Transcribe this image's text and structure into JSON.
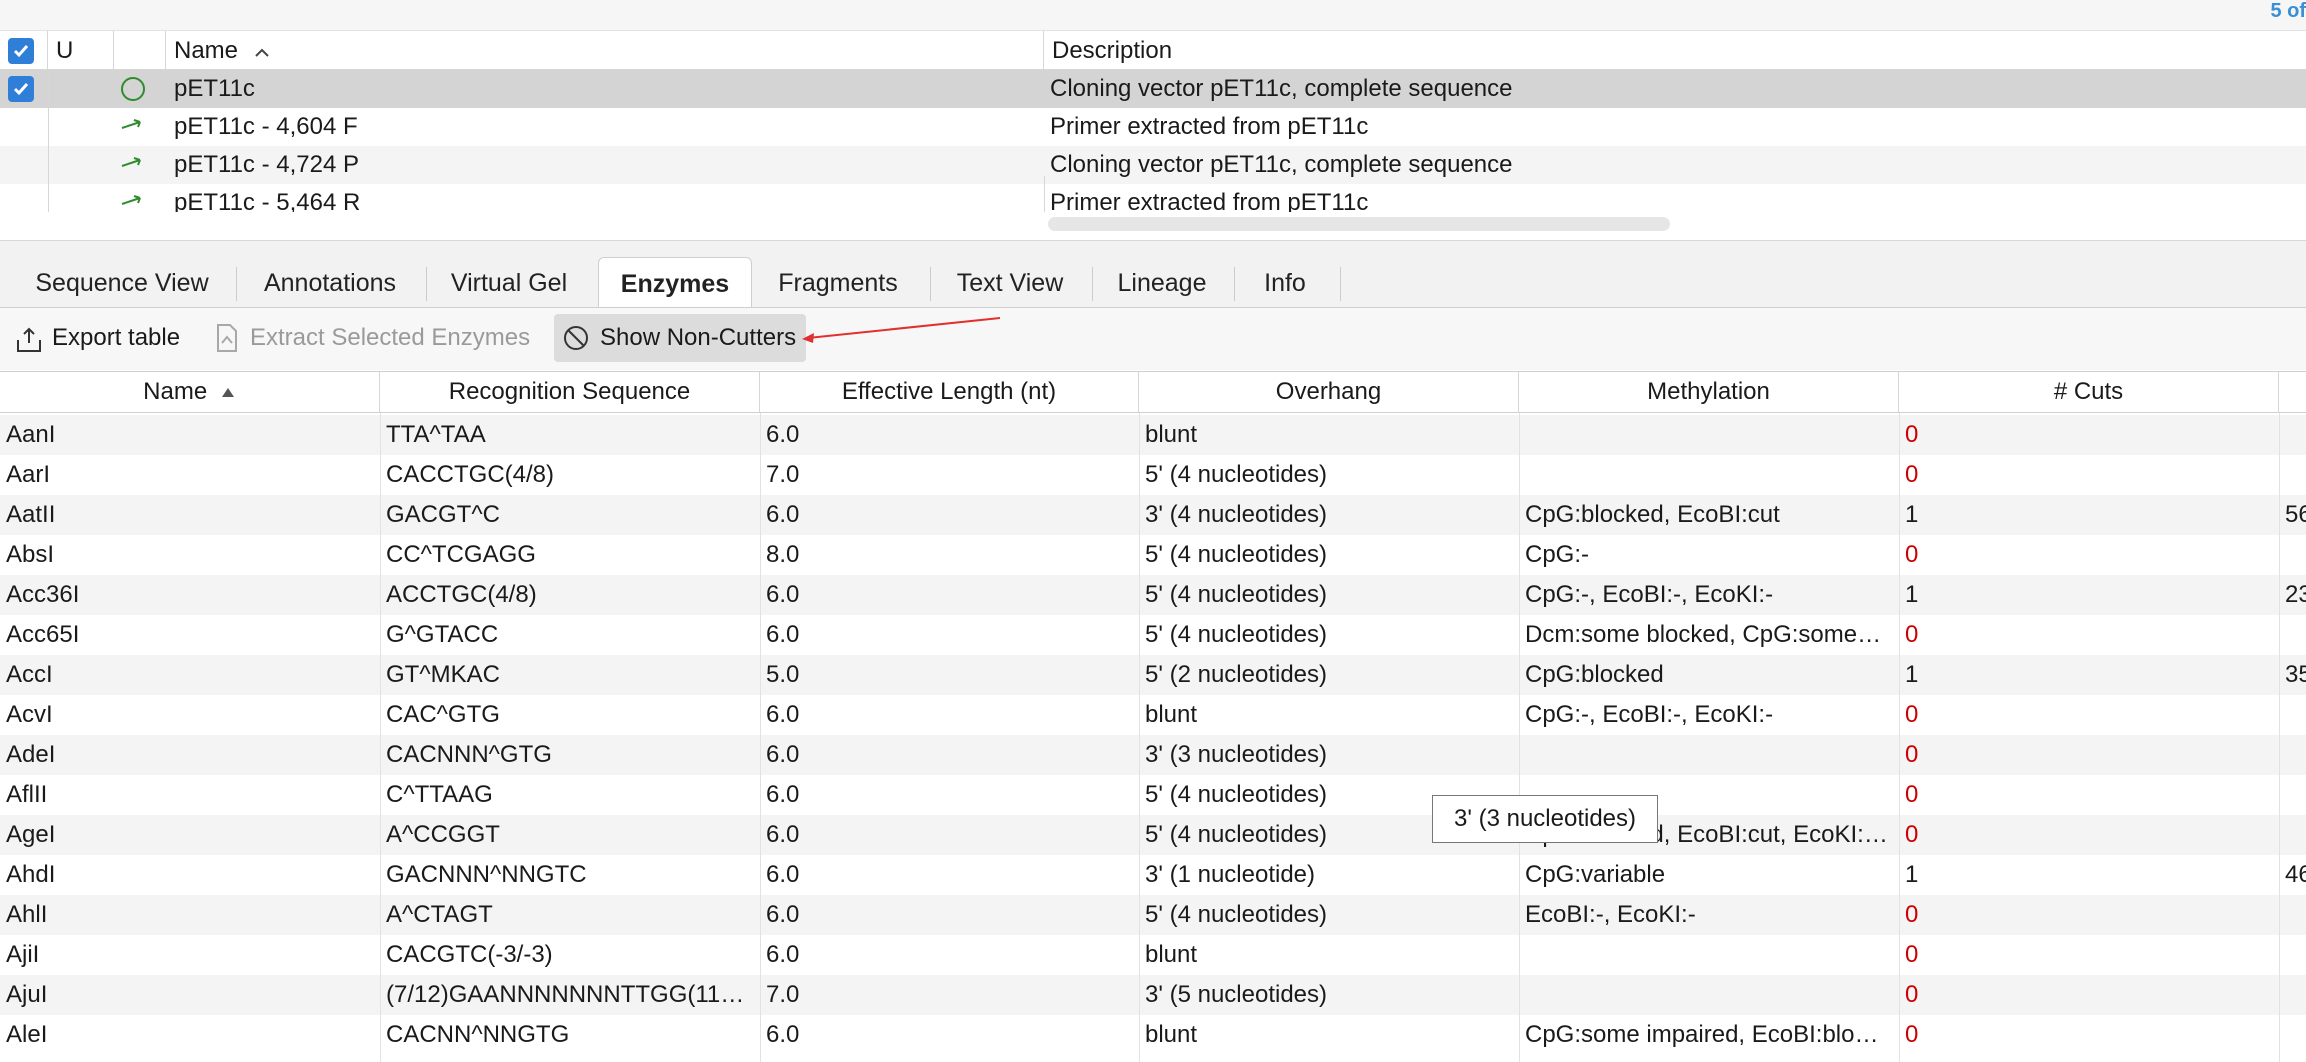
{
  "count_label": "5 of",
  "doc_table": {
    "columns": {
      "u": "U",
      "name": "Name",
      "description": "Description"
    },
    "rows": [
      {
        "name": "pET11c",
        "description": "Cloning vector pET11c, complete sequence",
        "icon": "circle-sequence-icon",
        "checked": true
      },
      {
        "name": "pET11c - 4,604 F",
        "description": "Primer extracted from pET11c",
        "icon": "primer-forward-icon",
        "checked": false
      },
      {
        "name": "pET11c - 4,724 P",
        "description": "Cloning vector pET11c, complete sequence",
        "icon": "primer-forward-icon",
        "checked": false
      },
      {
        "name": "pET11c - 5,464 R",
        "description": "Primer extracted from pET11c",
        "icon": "primer-forward-icon",
        "checked": false
      }
    ]
  },
  "tabs": [
    "Sequence View",
    "Annotations",
    "Virtual Gel",
    "Enzymes",
    "Fragments",
    "Text View",
    "Lineage",
    "Info"
  ],
  "active_tab": "Enzymes",
  "toolbar": {
    "export": "Export table",
    "extract": "Extract Selected Enzymes",
    "show_non_cutters": "Show Non-Cutters"
  },
  "enzyme_table": {
    "columns": {
      "name": "Name",
      "recognition": "Recognition Sequence",
      "length": "Effective Length (nt)",
      "overhang": "Overhang",
      "methylation": "Methylation",
      "cuts": "# Cuts"
    },
    "rows": [
      {
        "name": "AanI",
        "recognition": "TTA^TAA",
        "length": "6.0",
        "overhang": "blunt",
        "methylation": "",
        "cuts": "0",
        "extra": ""
      },
      {
        "name": "AarI",
        "recognition": "CACCTGC(4/8)",
        "length": "7.0",
        "overhang": "5' (4 nucleotides)",
        "methylation": "",
        "cuts": "0",
        "extra": ""
      },
      {
        "name": "AatII",
        "recognition": "GACGT^C",
        "length": "6.0",
        "overhang": "3' (4 nucleotides)",
        "methylation": "CpG:blocked, EcoBI:cut",
        "cuts": "1",
        "extra": "56"
      },
      {
        "name": "AbsI",
        "recognition": "CC^TCGAGG",
        "length": "8.0",
        "overhang": "5' (4 nucleotides)",
        "methylation": "CpG:-",
        "cuts": "0",
        "extra": ""
      },
      {
        "name": "Acc36I",
        "recognition": "ACCTGC(4/8)",
        "length": "6.0",
        "overhang": "5' (4 nucleotides)",
        "methylation": "CpG:-, EcoBI:-, EcoKI:-",
        "cuts": "1",
        "extra": "23"
      },
      {
        "name": "Acc65I",
        "recognition": "G^GTACC",
        "length": "6.0",
        "overhang": "5' (4 nucleotides)",
        "methylation": "Dcm:some blocked, CpG:some…",
        "cuts": "0",
        "extra": ""
      },
      {
        "name": "AccI",
        "recognition": "GT^MKAC",
        "length": "5.0",
        "overhang": "5' (2 nucleotides)",
        "methylation": "CpG:blocked",
        "cuts": "1",
        "extra": "35"
      },
      {
        "name": "AcvI",
        "recognition": "CAC^GTG",
        "length": "6.0",
        "overhang": "blunt",
        "methylation": "CpG:-, EcoBI:-, EcoKI:-",
        "cuts": "0",
        "extra": ""
      },
      {
        "name": "AdeI",
        "recognition": "CACNNN^GTG",
        "length": "6.0",
        "overhang": "3' (3 nucleotides)",
        "methylation": "",
        "cuts": "0",
        "extra": ""
      },
      {
        "name": "AflII",
        "recognition": "C^TTAAG",
        "length": "6.0",
        "overhang": "5' (4 nucleotides)",
        "methylation": "",
        "cuts": "0",
        "extra": ""
      },
      {
        "name": "AgeI",
        "recognition": "A^CCGGT",
        "length": "6.0",
        "overhang": "5' (4 nucleotides)",
        "methylation": "CpG:blocked, EcoBI:cut, EcoKI:…",
        "cuts": "0",
        "extra": ""
      },
      {
        "name": "AhdI",
        "recognition": "GACNNN^NNGTC",
        "length": "6.0",
        "overhang": "3' (1 nucleotide)",
        "methylation": "CpG:variable",
        "cuts": "1",
        "extra": "46"
      },
      {
        "name": "AhlI",
        "recognition": "A^CTAGT",
        "length": "6.0",
        "overhang": "5' (4 nucleotides)",
        "methylation": "EcoBI:-, EcoKI:-",
        "cuts": "0",
        "extra": ""
      },
      {
        "name": "AjiI",
        "recognition": "CACGTC(-3/-3)",
        "length": "6.0",
        "overhang": "blunt",
        "methylation": "",
        "cuts": "0",
        "extra": ""
      },
      {
        "name": "AjuI",
        "recognition": "(7/12)GAANNNNNNNTTGG(11…",
        "length": "7.0",
        "overhang": "3' (5 nucleotides)",
        "methylation": "",
        "cuts": "0",
        "extra": ""
      },
      {
        "name": "AleI",
        "recognition": "CACNN^NNGTG",
        "length": "6.0",
        "overhang": "blunt",
        "methylation": "CpG:some impaired, EcoBI:blo…",
        "cuts": "0",
        "extra": ""
      }
    ]
  },
  "tooltip": "3' (3 nucleotides)",
  "colors": {
    "accent": "#2f7fd8",
    "zero_cuts": "#cc0000",
    "green_icon": "#2e8b2e",
    "arrow": "#e03030"
  }
}
